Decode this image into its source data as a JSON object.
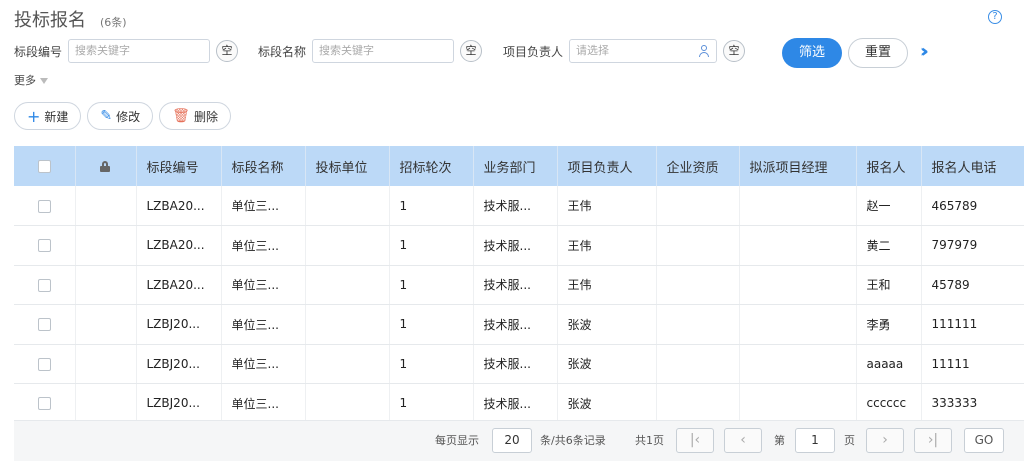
{
  "header": {
    "title": "投标报名",
    "count": "(6条)",
    "help_icon": "question-circle-icon"
  },
  "filters": [
    {
      "label": "标段编号",
      "placeholder": "搜索关键字",
      "clear": "空"
    },
    {
      "label": "标段名称",
      "placeholder": "搜索关键字",
      "clear": "空"
    },
    {
      "label": "项目负责人",
      "placeholder": "请选择",
      "clear": "空"
    }
  ],
  "buttons": {
    "filter": "筛选",
    "reset": "重置",
    "expand": "»"
  },
  "more": "更多",
  "actions": {
    "new": "新建",
    "edit": "修改",
    "delete": "删除"
  },
  "table": {
    "columns": [
      "标段编号",
      "标段名称",
      "投标单位",
      "招标轮次",
      "业务部门",
      "项目负责人",
      "企业资质",
      "拟派项目经理",
      "报名人",
      "报名人电话"
    ],
    "rows": [
      [
        "LZBA20...",
        "单位三...",
        "",
        "1",
        "技术服...",
        "王伟",
        "",
        "",
        "赵一",
        "465789"
      ],
      [
        "LZBA20...",
        "单位三...",
        "",
        "1",
        "技术服...",
        "王伟",
        "",
        "",
        "黄二",
        "797979"
      ],
      [
        "LZBA20...",
        "单位三...",
        "",
        "1",
        "技术服...",
        "王伟",
        "",
        "",
        "王和",
        "45789"
      ],
      [
        "LZBJ20...",
        "单位三...",
        "",
        "1",
        "技术服...",
        "张波",
        "",
        "",
        "李勇",
        "111111"
      ],
      [
        "LZBJ20...",
        "单位三...",
        "",
        "1",
        "技术服...",
        "张波",
        "",
        "",
        "aaaaa",
        "11111"
      ],
      [
        "LZBJ20...",
        "单位三...",
        "",
        "1",
        "技术服...",
        "张波",
        "",
        "",
        "cccccc",
        "333333"
      ]
    ]
  },
  "pagination": {
    "per_page_label": "每页显示",
    "per_page": "20",
    "total_label": "条/共6条记录",
    "pages_label": "共1页",
    "page_prefix": "第",
    "page": "1",
    "page_suffix": "页",
    "go": "GO"
  },
  "colors": {
    "accent": "#2e88e6",
    "header_bg": "#bcd9f7"
  }
}
